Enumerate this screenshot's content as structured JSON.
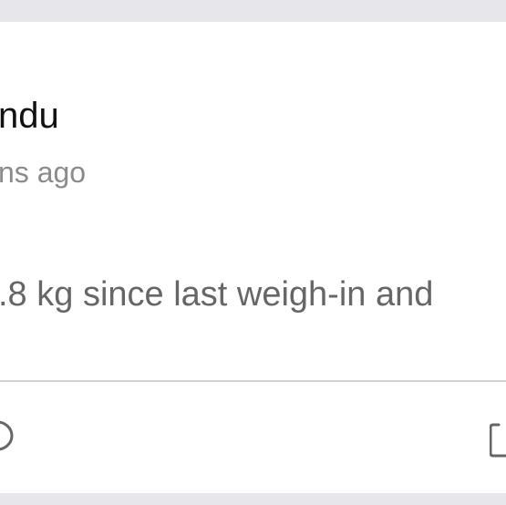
{
  "post": {
    "author_name": "ndu",
    "timestamp": "ns ago",
    "message": ".8 kg since last weigh-in and"
  },
  "actions": {
    "left_icon": "comment-icon",
    "right_icon": "share-icon"
  },
  "colors": {
    "background": "#e6e6eb",
    "card": "#ffffff",
    "title": "#111111",
    "secondary_text": "#8a8a8f",
    "body_text": "#666666",
    "divider": "#d0d0d5"
  }
}
